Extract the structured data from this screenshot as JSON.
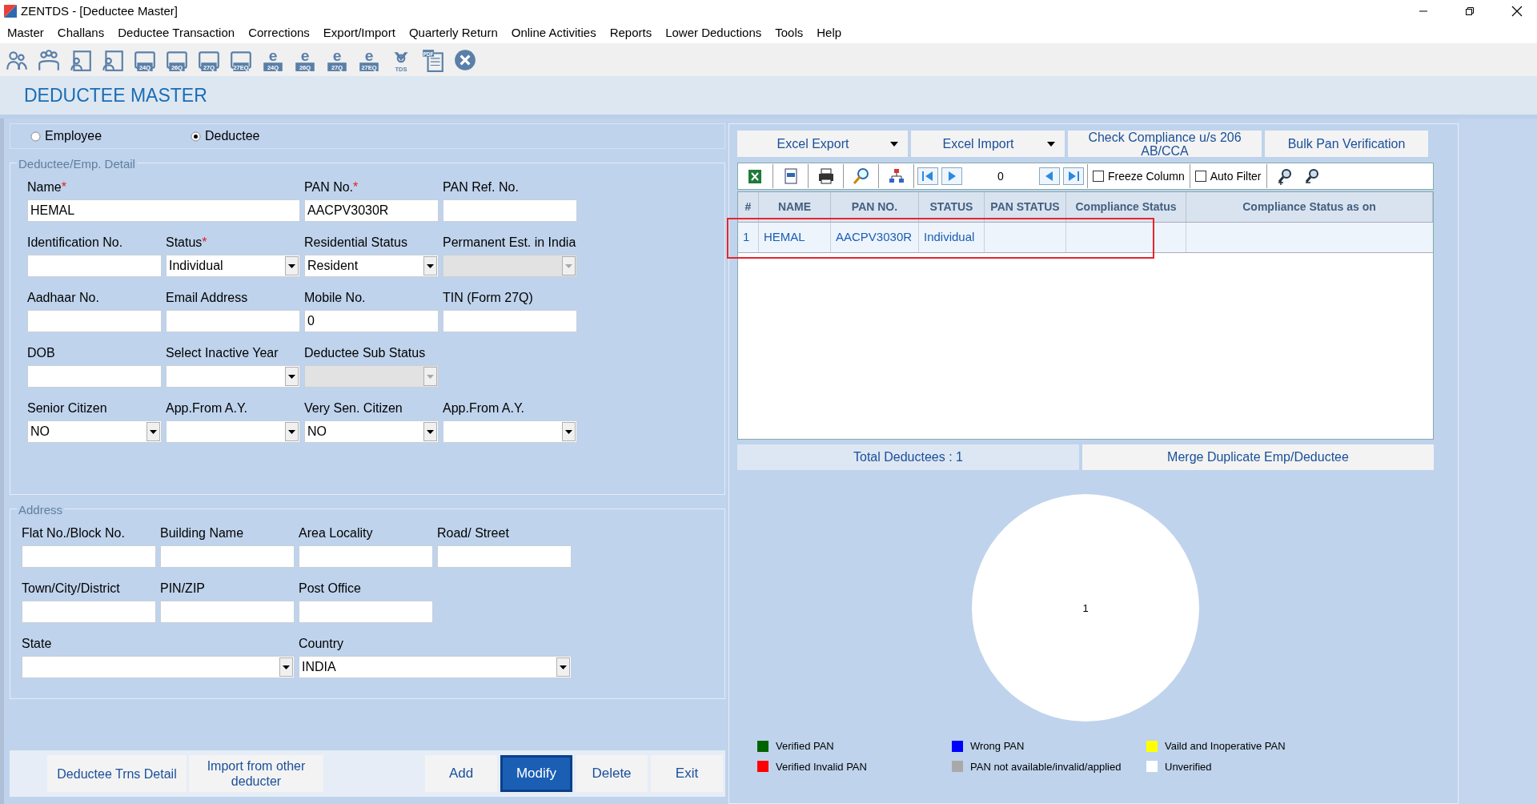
{
  "window": {
    "title": "ZENTDS - [Deductee Master]"
  },
  "menu": [
    "Master",
    "Challans",
    "Deductee Transaction",
    "Corrections",
    "Export/Import",
    "Quarterly Return",
    "Online Activities",
    "Reports",
    "Lower Deductions",
    "Tools",
    "Help"
  ],
  "toolbar": [
    {
      "kind": "person"
    },
    {
      "kind": "group"
    },
    {
      "kind": "card"
    },
    {
      "kind": "card"
    },
    {
      "kind": "form",
      "label": "24Q"
    },
    {
      "kind": "form",
      "label": "26Q"
    },
    {
      "kind": "form",
      "label": "27Q"
    },
    {
      "kind": "form",
      "label": "27EQ"
    },
    {
      "kind": "efile",
      "letter": "e",
      "label": "24Q"
    },
    {
      "kind": "efile",
      "letter": "e",
      "label": "26Q"
    },
    {
      "kind": "efile",
      "letter": "e",
      "label": "27Q"
    },
    {
      "kind": "efile",
      "letter": "e",
      "label": "27EQ"
    },
    {
      "kind": "emblem",
      "label": "TDS"
    },
    {
      "kind": "pdf",
      "label": "PDF"
    },
    {
      "kind": "close"
    }
  ],
  "page_title": "DEDUCTEE MASTER",
  "required_mark": "*",
  "type_options": [
    {
      "label": "Employee",
      "selected": false
    },
    {
      "label": "Deductee",
      "selected": true
    }
  ],
  "detail": {
    "legend": "Deductee/Emp. Detail",
    "fields": [
      {
        "label": "Name",
        "required": true,
        "kind": "text",
        "value": "HEMAL",
        "wide": true,
        "disabled": false
      },
      {
        "label": "PAN No.",
        "required": true,
        "kind": "text",
        "value": "AACPV3030R",
        "wide": false,
        "disabled": false
      },
      {
        "label": "PAN Ref. No.",
        "required": false,
        "kind": "text",
        "wide": false,
        "disabled": false
      },
      {
        "label": "Identification No.",
        "required": false,
        "kind": "text",
        "wide": false,
        "disabled": false
      },
      {
        "label": "Status",
        "required": true,
        "kind": "select",
        "value": "Individual",
        "wide": false,
        "disabled": false
      },
      {
        "label": "Residential Status",
        "required": false,
        "kind": "select",
        "value": "Resident",
        "wide": false,
        "disabled": false
      },
      {
        "label": "Permanent Est. in India",
        "required": false,
        "kind": "select",
        "wide": false,
        "disabled": true
      },
      {
        "label": "Aadhaar No.",
        "required": false,
        "kind": "text",
        "wide": false,
        "disabled": false
      },
      {
        "label": "Email Address",
        "required": false,
        "kind": "text",
        "wide": false,
        "disabled": false
      },
      {
        "label": "Mobile No.",
        "required": false,
        "kind": "text",
        "value": "0",
        "wide": false,
        "disabled": false
      },
      {
        "label": "TIN (Form 27Q)",
        "required": false,
        "kind": "text",
        "wide": false,
        "disabled": false
      },
      {
        "label": "DOB",
        "required": false,
        "kind": "text",
        "wide": false,
        "disabled": false
      },
      {
        "label": "Select Inactive Year",
        "required": false,
        "kind": "select",
        "wide": false,
        "disabled": false
      },
      {
        "label": "Deductee Sub Status",
        "required": false,
        "kind": "select",
        "wide": false,
        "disabled": true
      },
      {
        "kind": "blank"
      },
      {
        "label": "Senior Citizen",
        "required": false,
        "kind": "select",
        "value": "NO",
        "wide": false,
        "disabled": false
      },
      {
        "label": "App.From A.Y.",
        "required": false,
        "kind": "select",
        "wide": false,
        "disabled": false
      },
      {
        "label": "Very Sen. Citizen",
        "required": false,
        "kind": "select",
        "value": "NO",
        "wide": false,
        "disabled": false
      },
      {
        "label": "App.From A.Y.",
        "required": false,
        "kind": "select",
        "wide": false,
        "disabled": false
      }
    ]
  },
  "address": {
    "legend": "Address",
    "fields": [
      {
        "label": "Flat No./Block No.",
        "required": false,
        "kind": "text",
        "wide": false,
        "disabled": false
      },
      {
        "label": "Building Name",
        "required": false,
        "kind": "text",
        "wide": false,
        "disabled": false
      },
      {
        "label": "Area Locality",
        "required": false,
        "kind": "text",
        "wide": false,
        "disabled": false
      },
      {
        "label": "Road/ Street",
        "required": false,
        "kind": "text",
        "wide": false,
        "disabled": false
      },
      {
        "label": "Town/City/District",
        "required": false,
        "kind": "text",
        "wide": false,
        "disabled": false
      },
      {
        "label": "PIN/ZIP",
        "required": false,
        "kind": "text",
        "wide": false,
        "disabled": false
      },
      {
        "label": "Post Office",
        "required": false,
        "kind": "text",
        "wide": false,
        "disabled": false
      },
      {
        "kind": "blank"
      },
      {
        "label": "State",
        "required": false,
        "kind": "select",
        "wide": true,
        "disabled": false
      },
      {
        "label": "Country",
        "required": false,
        "kind": "select",
        "value": "INDIA",
        "wide": true,
        "disabled": false
      }
    ]
  },
  "left_actions": [
    {
      "label": "Deductee Trns Detail"
    },
    {
      "label": "Import from other deducter"
    }
  ],
  "actions": [
    {
      "label": "Add",
      "selected": false
    },
    {
      "label": "Modify",
      "selected": true
    },
    {
      "label": "Delete",
      "selected": false
    },
    {
      "label": "Exit",
      "selected": false
    }
  ],
  "grid": {
    "buttons": [
      {
        "label": "Excel Export",
        "dropdown": true
      },
      {
        "label": "Excel Import",
        "dropdown": true
      },
      {
        "label": "Check Compliance u/s 206 AB/CCA",
        "dropdown": false
      },
      {
        "label": "Bulk Pan Verification",
        "dropdown": false
      }
    ],
    "counter": "0",
    "checks": [
      {
        "label": "Freeze Column",
        "checked": false
      },
      {
        "label": "Auto Filter",
        "checked": false
      }
    ],
    "columns": [
      "#",
      "NAME",
      "PAN NO.",
      "STATUS",
      "PAN STATUS",
      "Compliance Status",
      "Compliance Status as on"
    ],
    "rows": [
      {
        "index": "1",
        "name": "HEMAL",
        "pan": "AACPV3030R",
        "status": "Individual",
        "selected": true,
        "outlined": true
      }
    ]
  },
  "totals": "Total Deductees : 1",
  "merge_button": "Merge Duplicate Emp/Deductee",
  "chart": {
    "chart_data": {
      "type": "pie",
      "series": [
        {
          "color": "#ffffff",
          "values": [
            1
          ]
        }
      ],
      "data_labels": true
    }
  },
  "legend": [
    {
      "label": "Verified PAN",
      "color": "#006400"
    },
    {
      "label": "Wrong PAN",
      "color": "#0000ff"
    },
    {
      "label": "Vaild and Inoperative PAN",
      "color": "#ffff00"
    },
    {
      "label": "Verified Invalid PAN",
      "color": "#ff0000"
    },
    {
      "label": "PAN not available/invalid/applied",
      "color": "#a9a9a9"
    },
    {
      "label": "Unverified",
      "color": "#ffffff"
    }
  ]
}
